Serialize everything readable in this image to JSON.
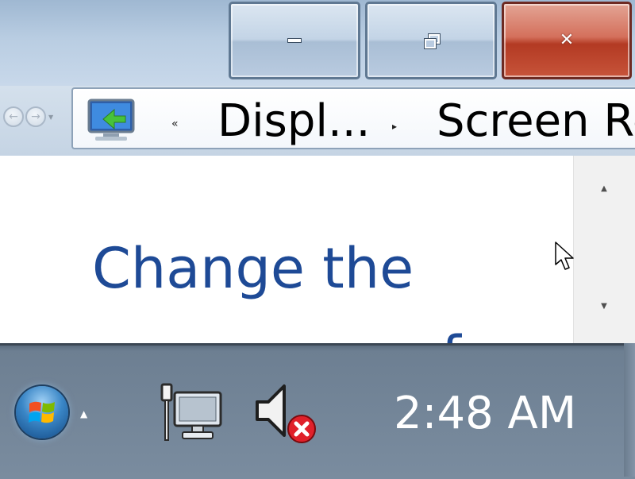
{
  "window": {
    "caption_buttons": [
      {
        "name": "minimize",
        "icon": "minimize-icon"
      },
      {
        "name": "maximize",
        "icon": "restore-icon"
      },
      {
        "name": "close",
        "icon": "close-icon"
      }
    ]
  },
  "nav": {
    "back_icon": "back-arrow-icon",
    "forward_icon": "forward-arrow-icon",
    "recent_dropdown_icon": "chevron-down-icon"
  },
  "address_bar": {
    "location_icon": "display-control-panel-icon",
    "overflow_chevron": "«",
    "segments": [
      "Displ...",
      "Screen Re"
    ],
    "separator": "▸"
  },
  "content": {
    "heading": "Change the",
    "heading_next_line_fragment": "f"
  },
  "scrollbar": {
    "up_arrow": "▲",
    "down_arrow": "▼"
  },
  "taskbar": {
    "start_icon": "windows-start-orb-icon",
    "tray_expand": "▲",
    "tray_icons": [
      "network-icon",
      "volume-muted-icon"
    ],
    "clock": "2:48 AM"
  },
  "colors": {
    "heading_text": "#1e4a96",
    "close_button": "#c7543a",
    "taskbar": "#6d7f92"
  }
}
